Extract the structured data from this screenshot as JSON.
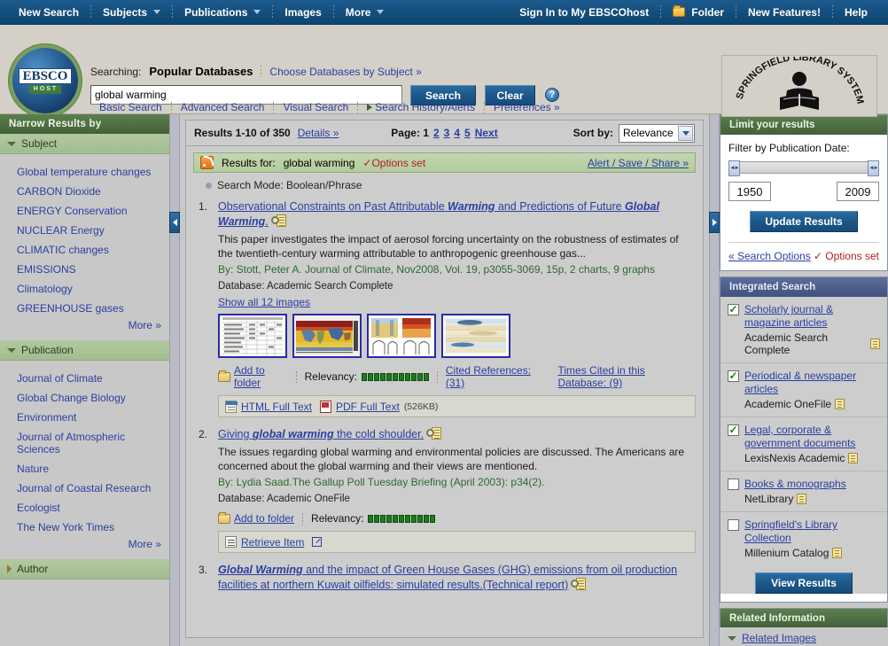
{
  "topnav": {
    "left": [
      {
        "label": "New Search",
        "has_caret": false
      },
      {
        "label": "Subjects",
        "has_caret": true
      },
      {
        "label": "Publications",
        "has_caret": true
      },
      {
        "label": "Images",
        "has_caret": false
      },
      {
        "label": "More",
        "has_caret": true
      }
    ],
    "right": [
      {
        "label": "Sign In to My EBSCOhost",
        "icon": ""
      },
      {
        "label": "Folder",
        "icon": "folder-icon"
      },
      {
        "label": "New Features!",
        "icon": ""
      },
      {
        "label": "Help",
        "icon": ""
      }
    ]
  },
  "header": {
    "searching_label": "Searching:",
    "database": "Popular Databases",
    "choose_db_link": "Choose Databases by Subject »",
    "search_value": "global warming",
    "search_placeholder": "",
    "search_button": "Search",
    "clear_button": "Clear",
    "help_glyph": "?",
    "logo_top": "EBSCO",
    "logo_bottom": "HOST",
    "library_logo_top": "SPRINGFIELD LIBRARY",
    "library_logo_right": "SYSTEM",
    "subnav": [
      "Basic Search",
      "Advanced Search",
      "Visual Search",
      "Search History/Alerts",
      "Preferences »"
    ]
  },
  "left_sidebar": {
    "title": "Narrow Results by",
    "facets": [
      {
        "name": "Subject",
        "expanded": true,
        "items": [
          "Global temperature changes",
          "CARBON Dioxide",
          "ENERGY Conservation",
          "NUCLEAR Energy",
          "CLIMATIC changes",
          "EMISSIONS",
          "Climatology",
          "GREENHOUSE gases"
        ],
        "more": "More »"
      },
      {
        "name": "Publication",
        "expanded": true,
        "items": [
          "Journal of Climate",
          "Global Change Biology",
          "Environment",
          "Journal of Atmospheric Sciences",
          "Nature",
          "Journal of Coastal Research",
          "Ecologist",
          "The New York Times"
        ],
        "more": "More »"
      },
      {
        "name": "Author",
        "expanded": false,
        "items": [],
        "more": ""
      }
    ]
  },
  "toolbar": {
    "results_count": "Results 1-10 of 350",
    "details_link": "Details »",
    "page_label": "Page: 1",
    "pages": [
      "2",
      "3",
      "4",
      "5"
    ],
    "next_label": "Next",
    "sort_label": "Sort by:",
    "sort_value": "Relevance"
  },
  "rss_bar": {
    "results_for_label": "Results for:",
    "query": "global warming",
    "options_set": "✓Options set",
    "alert_link": "Alert / Save / Share »"
  },
  "search_mode": "Search Mode: Boolean/Phrase",
  "results": [
    {
      "number": "1.",
      "title_parts": [
        {
          "text": "Observational Constraints on Past Attributable ",
          "em": false
        },
        {
          "text": "Warming",
          "em": true
        },
        {
          "text": " and Predictions of Future ",
          "em": false
        },
        {
          "text": "Global Warming",
          "em": true
        },
        {
          "text": ".",
          "em": false
        }
      ],
      "abstract": "This paper investigates the impact of aerosol forcing uncertainty on the robustness of estimates of the twentieth-century warming attributable to anthropogenic greenhouse gas...",
      "by": "By: Stott, Peter A. Journal of Climate, Nov2008, Vol. 19, p3055-3069, 15p, 2 charts, 9 graphs",
      "database": "Database: Academic Search Complete",
      "show_images": "Show all 12 images",
      "thumbnails": [
        "table-thumbnail",
        "world-map-thumbnail",
        "dual-plot-thumbnail",
        "contour-thumbnail"
      ],
      "add_to_folder": "Add to folder",
      "relevancy_label": "Relevancy:",
      "relevancy_bars": 11,
      "cited_references": "Cited References: (31)",
      "times_cited": "Times Cited in this Database: (9)",
      "fulltext": [
        {
          "label": "HTML Full Text",
          "icon": "html-icon",
          "size": ""
        },
        {
          "label": "PDF Full Text",
          "icon": "pdf-icon",
          "size": "(526KB)"
        }
      ]
    },
    {
      "number": "2.",
      "title_parts": [
        {
          "text": "Giving ",
          "em": false
        },
        {
          "text": "global warming",
          "em": true
        },
        {
          "text": " the cold shoulder.",
          "em": false
        }
      ],
      "abstract": "The issues regarding global warming and environmental policies are discussed. The Americans are concerned about the global warming and their views are mentioned.",
      "by": "By: Lydia Saad.The Gallup Poll Tuesday Briefing (April 2003): p34(2).",
      "database": "Database: Academic OneFile",
      "show_images": "",
      "thumbnails": [],
      "add_to_folder": "Add to folder",
      "relevancy_label": "Relevancy:",
      "relevancy_bars": 11,
      "cited_references": "",
      "times_cited": "",
      "fulltext": [
        {
          "label": "Retrieve Item",
          "icon": "list-icon",
          "size": ""
        }
      ]
    },
    {
      "number": "3.",
      "title_parts": [
        {
          "text": "Global Warming",
          "em": true
        },
        {
          "text": " and the impact of Green House Gases (GHG) emissions from oil production facilities at northern Kuwait oilfields: simulated results.(Technical report)",
          "em": false
        }
      ],
      "abstract": "",
      "by": "",
      "database": "",
      "show_images": "",
      "thumbnails": [],
      "add_to_folder": "",
      "relevancy_label": "",
      "relevancy_bars": 0,
      "cited_references": "",
      "times_cited": "",
      "fulltext": []
    }
  ],
  "right_sidebar": {
    "limit_panel": {
      "title": "Limit your results",
      "filter_label": "Filter by Publication Date:",
      "date_from": "1950",
      "date_to": "2009",
      "update_button": "Update Results",
      "search_options_link": "« Search Options",
      "options_set": "✓ Options set"
    },
    "integrated_search": {
      "title": "Integrated Search",
      "items": [
        {
          "checked": true,
          "label": "Scholarly journal & magazine articles",
          "sub": "Academic Search Complete"
        },
        {
          "checked": true,
          "label": "Periodical & newspaper articles",
          "sub": "Academic OneFile"
        },
        {
          "checked": true,
          "label": "Legal, corporate & government documents",
          "sub": "LexisNexis Academic"
        },
        {
          "checked": false,
          "label": "Books & monographs",
          "sub": "NetLibrary"
        },
        {
          "checked": false,
          "label": "Springfield's Library Collection",
          "sub": "Millenium Catalog"
        }
      ],
      "view_button": "View Results"
    },
    "related_information": {
      "title": "Related Information",
      "items": [
        "Related Images"
      ]
    }
  },
  "colors": {
    "nav_blue": "#15507f",
    "panel_green": "#4c6d41",
    "panel_blue": "#4a5c8a",
    "link_blue": "#2a3fa0",
    "accent_red": "#b02020",
    "body_gray": "#c8c8c8"
  }
}
